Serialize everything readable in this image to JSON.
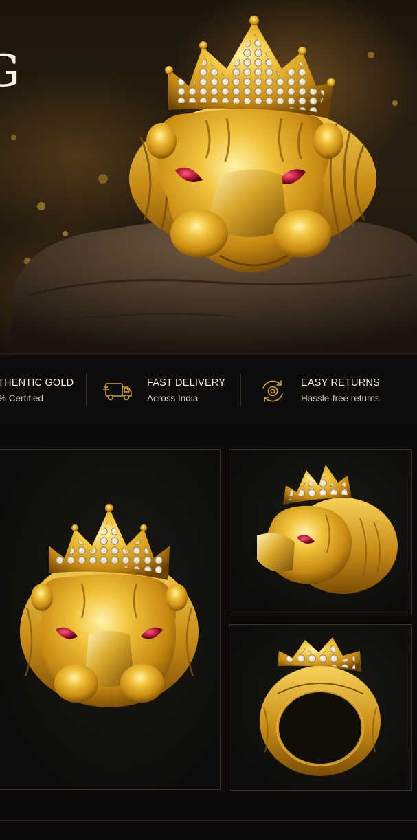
{
  "hero": {
    "title_fragment": "G",
    "image": "lion-head-gold-ring-on-rock"
  },
  "features": [
    {
      "icon": "gold-certified-icon",
      "title": "THENTIC GOLD",
      "subtitle": "% Certified"
    },
    {
      "icon": "delivery-truck-icon",
      "title": "FAST DELIVERY",
      "subtitle": "Across India"
    },
    {
      "icon": "returns-cycle-icon",
      "title": "EASY RETURNS",
      "subtitle": "Hassle-free returns"
    }
  ],
  "gallery": [
    {
      "view": "front",
      "image": "lion-ring-front-view"
    },
    {
      "view": "side",
      "image": "lion-ring-side-view"
    },
    {
      "view": "back",
      "image": "lion-ring-back-view"
    }
  ],
  "colors": {
    "accent_gold": "#d9a52c",
    "background": "#0a0907",
    "ruby": "#b0173a"
  }
}
